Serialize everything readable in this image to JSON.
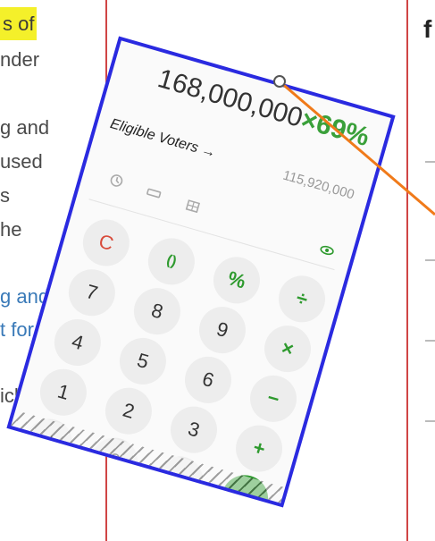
{
  "background": {
    "lines": [
      {
        "text": "s of",
        "highlight": true
      },
      {
        "text": "nder"
      },
      {
        "text": "g and"
      },
      {
        "text": "used"
      },
      {
        "text": "s"
      },
      {
        "text": "he"
      },
      {
        "text": "g and",
        "link": true
      },
      {
        "text": "t for",
        "link": true
      },
      {
        "text": "ich"
      }
    ],
    "right_text": "f"
  },
  "calculator": {
    "expression_number": "168,000,000",
    "expression_op": "×69%",
    "label": "Eligible Voters →",
    "result": "115,920,000",
    "icons": [
      "history-icon",
      "ruler-icon",
      "grid-icon",
      "eye-icon"
    ],
    "keys": [
      "C",
      "()",
      "%",
      "÷",
      "7",
      "8",
      "9",
      "×",
      "4",
      "5",
      "6",
      "−",
      "1",
      "2",
      "3",
      "+",
      "+/−",
      "0",
      ".",
      "="
    ]
  },
  "colors": {
    "border": "#2a2ae0",
    "accent_green": "#2e9a2e",
    "clear_red": "#d84a3a",
    "pointer_orange": "#f07a1a",
    "highlight_yellow": "#f4f02a"
  }
}
